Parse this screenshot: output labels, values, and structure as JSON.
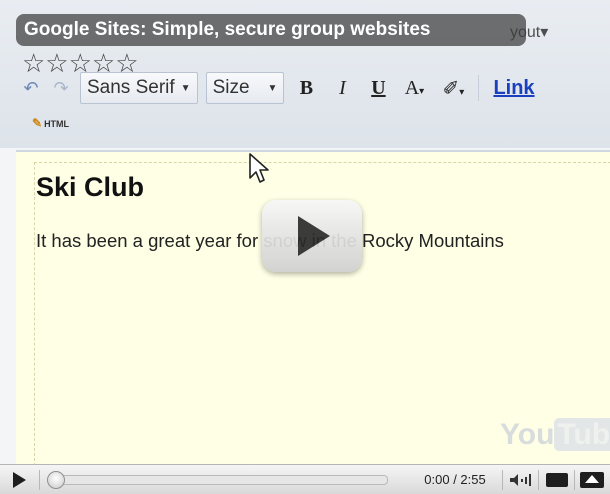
{
  "video": {
    "title": "Google Sites: Simple, secure group websites",
    "rating_stars": "☆☆☆☆☆",
    "watermark_you": "You",
    "watermark_tube": "Tube"
  },
  "editor": {
    "menu_partial": "yout",
    "font_family": "Sans Serif",
    "font_size": "Size",
    "bold": "B",
    "italic": "I",
    "underline": "U",
    "text_color": "A",
    "link": "Link",
    "html": "HTML"
  },
  "page": {
    "title": "Ski Club",
    "body": "It has been a great year for snow in the Rocky Mountains"
  },
  "player": {
    "current_time": "0:00",
    "duration": "2:55",
    "time_display": "0:00 / 2:55",
    "progress_fraction": 0
  },
  "colors": {
    "page_background": "#ffffe6",
    "link": "#1a3fbf",
    "title_overlay": "#3c3c3c"
  }
}
